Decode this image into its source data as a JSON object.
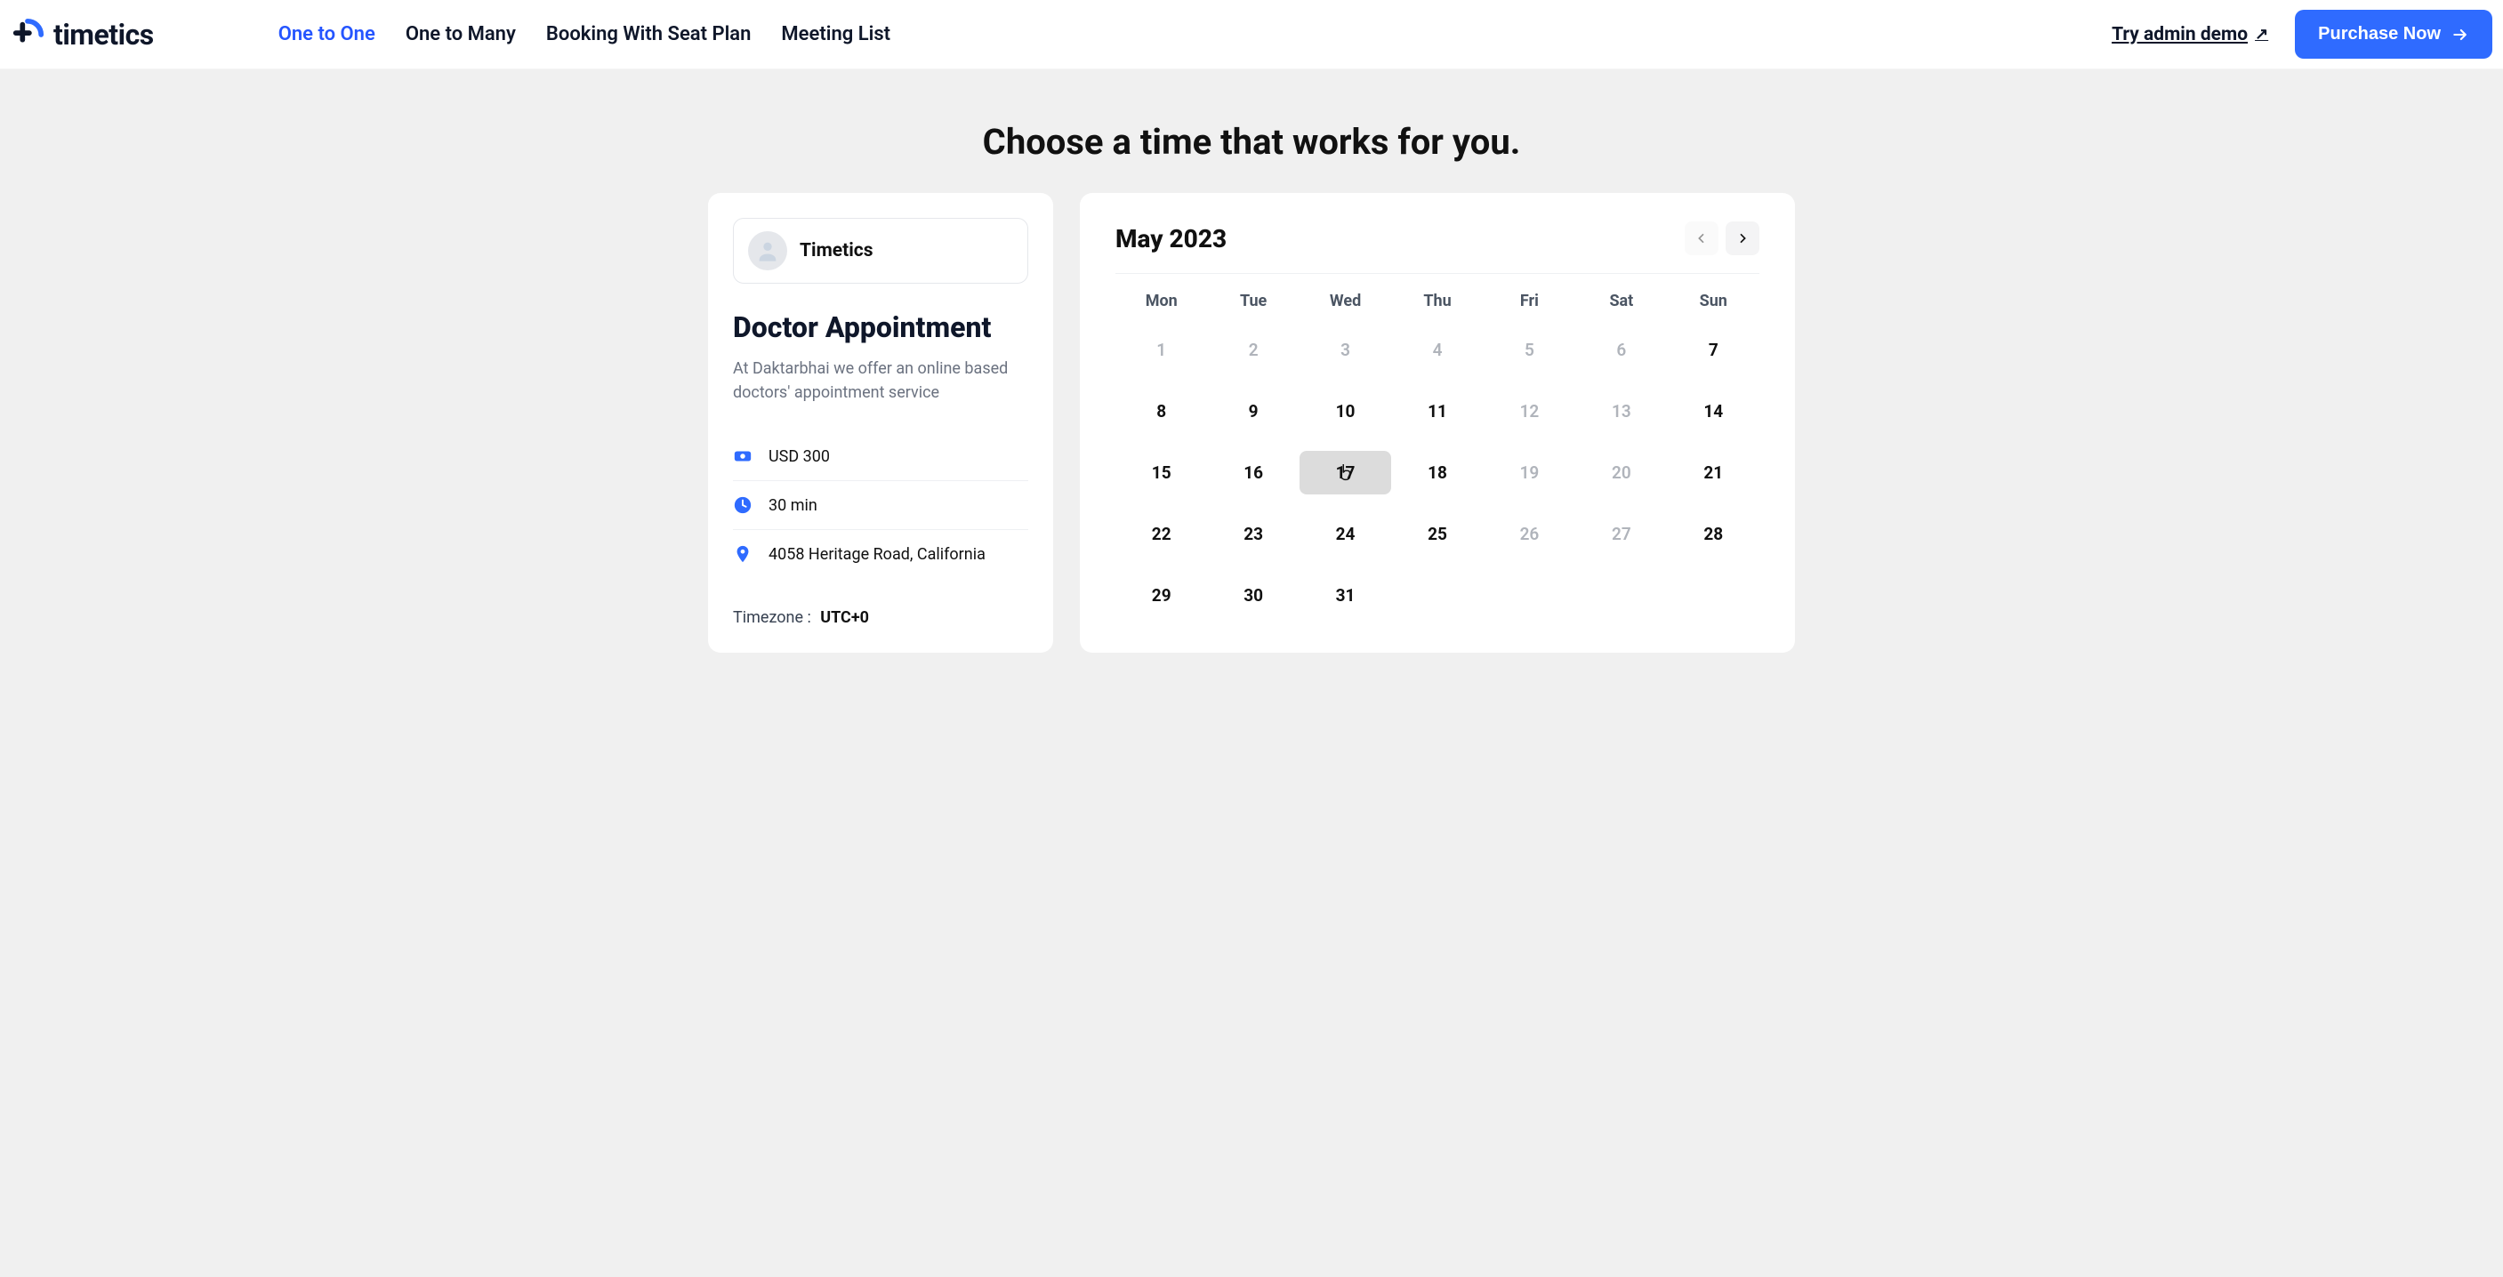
{
  "brand": {
    "name": "timetics"
  },
  "nav": {
    "items": [
      {
        "label": "One to One",
        "active": true
      },
      {
        "label": "One to Many",
        "active": false
      },
      {
        "label": "Booking With Seat Plan",
        "active": false
      },
      {
        "label": "Meeting List",
        "active": false
      }
    ],
    "demo_label": "Try admin demo",
    "purchase_label": "Purchase Now"
  },
  "heading": "Choose a time that works for you.",
  "info": {
    "org_name": "Timetics",
    "title": "Doctor Appointment",
    "description": "At Daktarbhai we offer an online based doctors' appointment service",
    "price": "USD 300",
    "duration": "30 min",
    "location": "4058 Heritage Road, California",
    "timezone_label": "Timezone :",
    "timezone_value": "UTC+0"
  },
  "calendar": {
    "month_label": "May 2023",
    "dow": [
      "Mon",
      "Tue",
      "Wed",
      "Thu",
      "Fri",
      "Sat",
      "Sun"
    ],
    "days": [
      {
        "n": "1",
        "muted": true
      },
      {
        "n": "2",
        "muted": true
      },
      {
        "n": "3",
        "muted": true
      },
      {
        "n": "4",
        "muted": true
      },
      {
        "n": "5",
        "muted": true
      },
      {
        "n": "6",
        "muted": true
      },
      {
        "n": "7",
        "muted": false
      },
      {
        "n": "8",
        "muted": false
      },
      {
        "n": "9",
        "muted": false
      },
      {
        "n": "10",
        "muted": false
      },
      {
        "n": "11",
        "muted": false
      },
      {
        "n": "12",
        "muted": true
      },
      {
        "n": "13",
        "muted": true
      },
      {
        "n": "14",
        "muted": false
      },
      {
        "n": "15",
        "muted": false
      },
      {
        "n": "16",
        "muted": false
      },
      {
        "n": "17",
        "muted": false,
        "hovered": true
      },
      {
        "n": "18",
        "muted": false
      },
      {
        "n": "19",
        "muted": true
      },
      {
        "n": "20",
        "muted": true
      },
      {
        "n": "21",
        "muted": false
      },
      {
        "n": "22",
        "muted": false
      },
      {
        "n": "23",
        "muted": false
      },
      {
        "n": "24",
        "muted": false
      },
      {
        "n": "25",
        "muted": false
      },
      {
        "n": "26",
        "muted": true
      },
      {
        "n": "27",
        "muted": true
      },
      {
        "n": "28",
        "muted": false
      },
      {
        "n": "29",
        "muted": false
      },
      {
        "n": "30",
        "muted": false
      },
      {
        "n": "31",
        "muted": false
      }
    ]
  }
}
